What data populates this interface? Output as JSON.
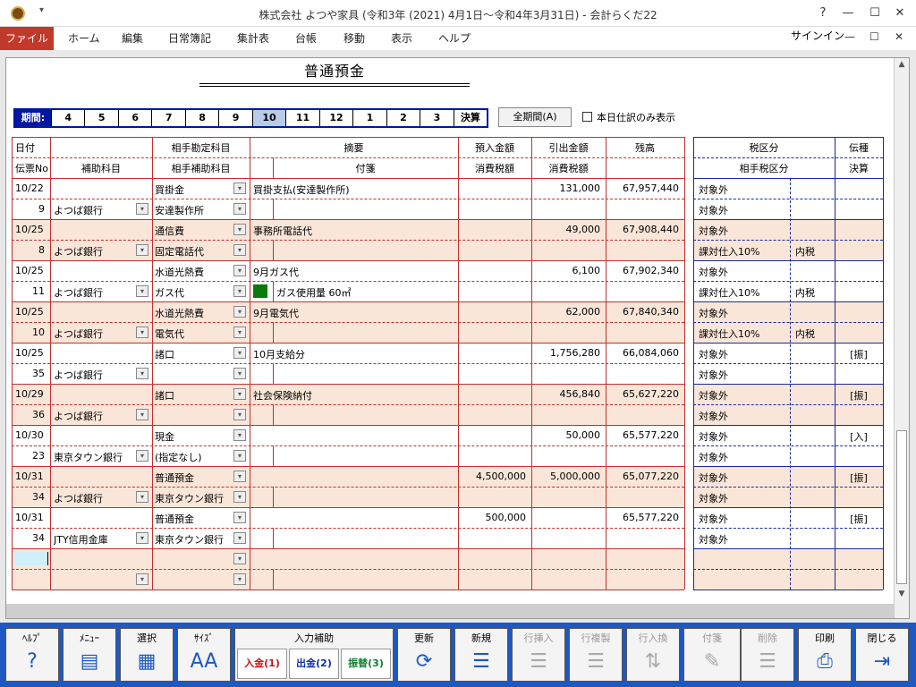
{
  "window": {
    "title": "株式会社 よつや家具 (令和3年 (2021) 4月1日～令和4年3月31日) - 会計らくだ22",
    "help": "?",
    "minimize": "—",
    "maximize": "☐",
    "close": "✕"
  },
  "menu": {
    "file": "ファイル",
    "items": [
      "ホーム",
      "編集",
      "日常簿記",
      "集計表",
      "台帳",
      "移動",
      "表示",
      "ヘルプ"
    ],
    "signin": "サインイン"
  },
  "ledger": {
    "title": "普通預金",
    "period_label": "期間:",
    "periods": [
      "4",
      "5",
      "6",
      "7",
      "8",
      "9",
      "10",
      "11",
      "12",
      "1",
      "2",
      "3",
      "決算"
    ],
    "active_period": "10",
    "all_period_button": "全期間(A)",
    "today_only": "本日仕訳のみ表示"
  },
  "headers": {
    "row1": [
      "日付",
      "",
      "相手勘定科目",
      "摘要",
      "預入金額",
      "引出金額",
      "残高",
      "税区分",
      "伝種"
    ],
    "row2": [
      "伝票No",
      "補助科目",
      "相手補助科目",
      "付箋",
      "消費税額",
      "消費税額",
      "",
      "相手税区分",
      "決算"
    ]
  },
  "entries": [
    {
      "date": "10/22",
      "no": "9",
      "sub": "よつば銀行",
      "acct": "買掛金",
      "acct_sub": "安達製作所",
      "desc": "買掛支払(安達製作所)",
      "memo": "",
      "deposit": "",
      "withdraw": "131,000",
      "balance": "67,957,440",
      "tax1": "対象外",
      "tax2": "対象外",
      "tax2_b": "",
      "kind": "",
      "shade": false
    },
    {
      "date": "10/25",
      "no": "8",
      "sub": "よつば銀行",
      "acct": "通信費",
      "acct_sub": "固定電話代",
      "desc": "事務所電話代",
      "memo": "",
      "deposit": "",
      "withdraw": "49,000",
      "balance": "67,908,440",
      "tax1": "対象外",
      "tax2": "課対仕入10%",
      "tax2_b": "内税",
      "kind": "",
      "shade": true
    },
    {
      "date": "10/25",
      "no": "11",
      "sub": "よつば銀行",
      "acct": "水道光熱費",
      "acct_sub": "ガス代",
      "desc": "9月ガス代",
      "memo": "ガス使用量 60㎥",
      "deposit": "",
      "withdraw": "6,100",
      "balance": "67,902,340",
      "tax1": "対象外",
      "tax2": "課対仕入10%",
      "tax2_b": "内税",
      "kind": "",
      "shade": false
    },
    {
      "date": "10/25",
      "no": "10",
      "sub": "よつば銀行",
      "acct": "水道光熱費",
      "acct_sub": "電気代",
      "desc": "9月電気代",
      "memo": "",
      "deposit": "",
      "withdraw": "62,000",
      "balance": "67,840,340",
      "tax1": "対象外",
      "tax2": "課対仕入10%",
      "tax2_b": "内税",
      "kind": "",
      "shade": true
    },
    {
      "date": "10/25",
      "no": "35",
      "sub": "よつば銀行",
      "acct": "諸口",
      "acct_sub": "",
      "desc": "10月支給分",
      "memo": "",
      "deposit": "",
      "withdraw": "1,756,280",
      "balance": "66,084,060",
      "tax1": "対象外",
      "tax2": "対象外",
      "tax2_b": "",
      "kind": "[振]",
      "shade": false
    },
    {
      "date": "10/29",
      "no": "36",
      "sub": "よつば銀行",
      "acct": "諸口",
      "acct_sub": "",
      "desc": "社会保険納付",
      "memo": "",
      "deposit": "",
      "withdraw": "456,840",
      "balance": "65,627,220",
      "tax1": "対象外",
      "tax2": "対象外",
      "tax2_b": "",
      "kind": "[振]",
      "shade": true
    },
    {
      "date": "10/30",
      "no": "23",
      "sub": "東京タウン銀行",
      "acct": "現金",
      "acct_sub": "(指定なし)",
      "desc": "",
      "memo": "",
      "deposit": "",
      "withdraw": "50,000",
      "balance": "65,577,220",
      "tax1": "対象外",
      "tax2": "対象外",
      "tax2_b": "",
      "kind": "[入]",
      "shade": false
    },
    {
      "date": "10/31",
      "no": "34",
      "sub": "よつば銀行",
      "acct": "普通預金",
      "acct_sub": "東京タウン銀行",
      "desc": "",
      "memo": "",
      "deposit": "4,500,000",
      "withdraw": "5,000,000",
      "balance": "65,077,220",
      "tax1": "対象外",
      "tax2": "対象外",
      "tax2_b": "",
      "kind": "[振]",
      "shade": true
    },
    {
      "date": "10/31",
      "no": "34",
      "sub": "JTY信用金庫",
      "acct": "普通預金",
      "acct_sub": "東京タウン銀行",
      "desc": "",
      "memo": "",
      "deposit": "500,000",
      "withdraw": "",
      "balance": "65,577,220",
      "tax1": "対象外",
      "tax2": "対象外",
      "tax2_b": "",
      "kind": "[振]",
      "shade": false
    }
  ],
  "toolbar": [
    {
      "label": "ﾍﾙﾌﾟ",
      "icon": "?",
      "name": "help",
      "enabled": true
    },
    {
      "label": "ﾒﾆｭｰ",
      "icon": "▤",
      "name": "menu",
      "enabled": true
    },
    {
      "label": "選択",
      "icon": "▦",
      "name": "select",
      "enabled": true
    },
    {
      "label": "ｻｲｽﾞ",
      "icon": "AA",
      "name": "size",
      "enabled": true
    },
    {
      "label": "更新",
      "icon": "⟳",
      "name": "refresh",
      "enabled": true
    },
    {
      "label": "新規",
      "icon": "☰",
      "name": "new",
      "enabled": true
    },
    {
      "label": "行挿入",
      "icon": "☰",
      "name": "insert-row",
      "enabled": false
    },
    {
      "label": "行複製",
      "icon": "☰",
      "name": "copy-row",
      "enabled": false
    },
    {
      "label": "行入換",
      "icon": "⇅",
      "name": "swap-row",
      "enabled": false
    },
    {
      "label": "付箋",
      "icon": "✎",
      "name": "sticky",
      "enabled": false
    },
    {
      "label": "削除",
      "icon": "☰",
      "name": "delete",
      "enabled": false
    },
    {
      "label": "印刷",
      "icon": "⎙",
      "name": "print",
      "enabled": true
    },
    {
      "label": "閉じる",
      "icon": "⇥",
      "name": "close",
      "enabled": true
    }
  ],
  "input_assist": {
    "label": "入力補助",
    "deposit": "入金(1)",
    "withdraw": "出金(2)",
    "transfer": "振替(3)"
  },
  "colors": {
    "menu_active": "#c0392b",
    "accent_blue": "#1e58c0",
    "row_shade": "#fae6d8",
    "grid_red": "#c03030",
    "grid_blue": "#1a2a9a"
  }
}
